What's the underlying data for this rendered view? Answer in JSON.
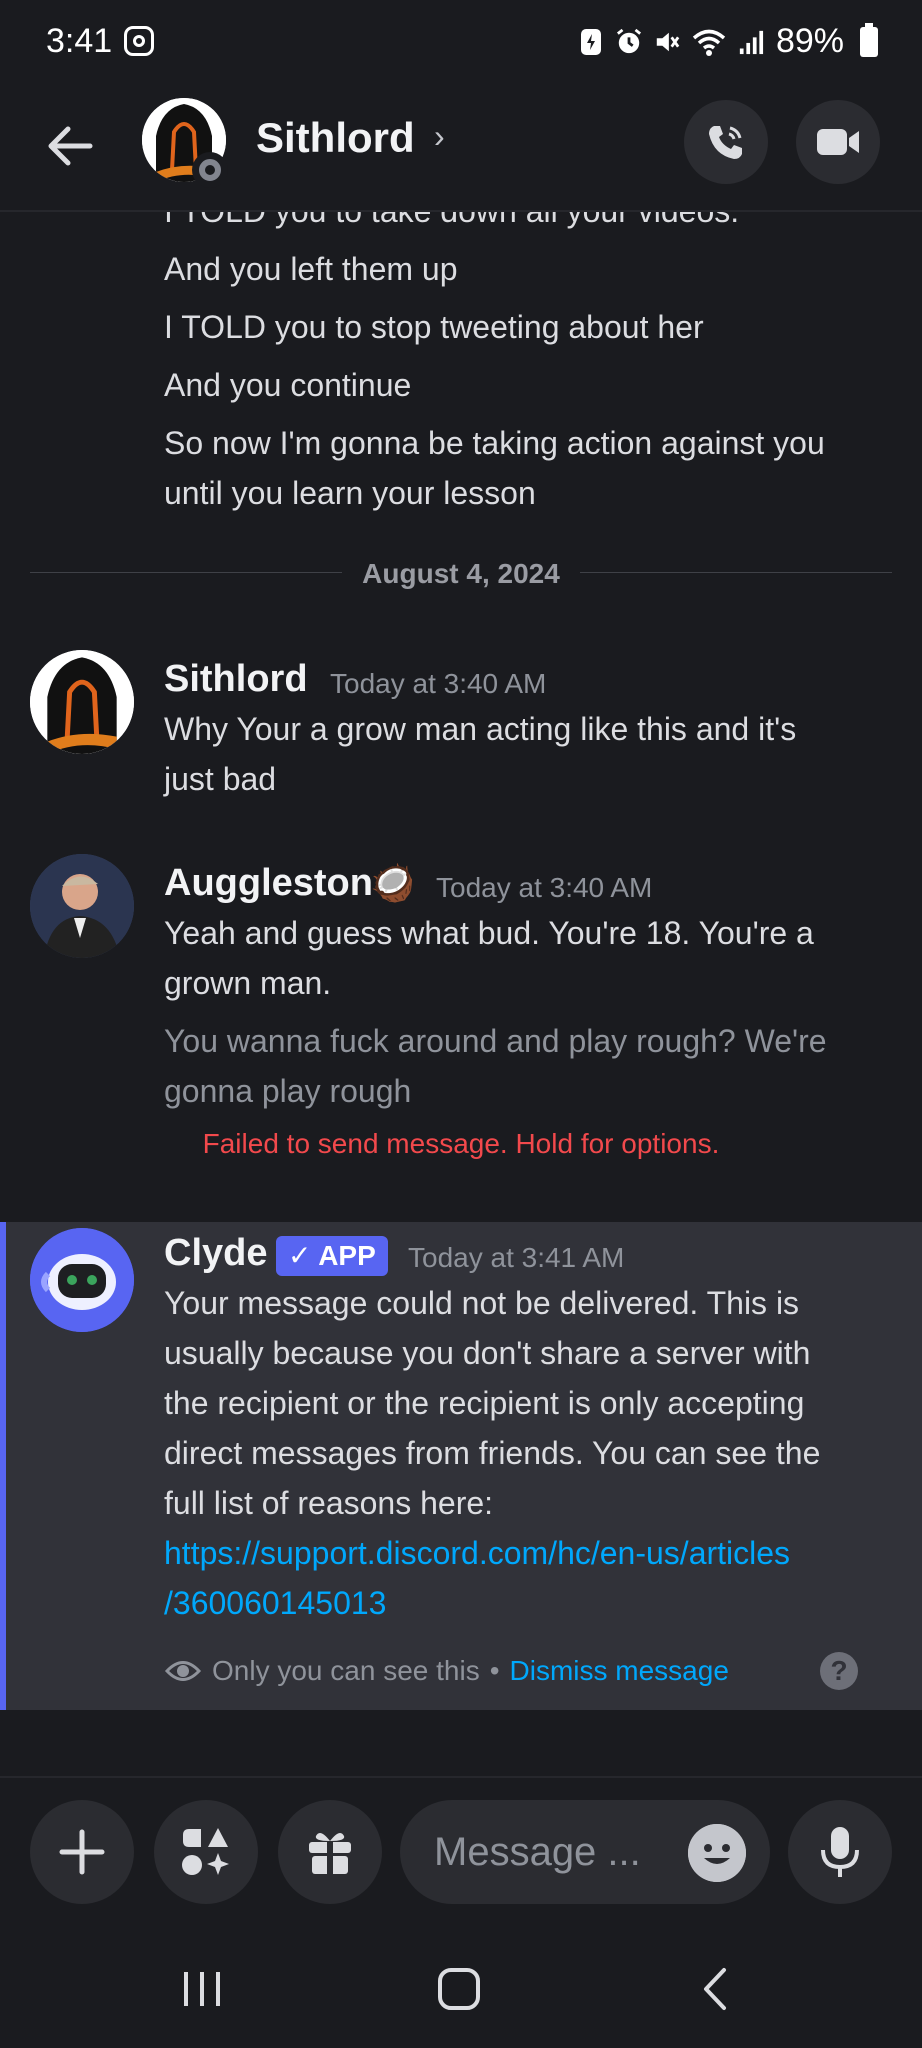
{
  "status_bar": {
    "time": "3:41",
    "battery": "89%"
  },
  "header": {
    "contact_name": "Sithlord",
    "chevron": "›"
  },
  "messages": {
    "previous_lines": [
      "I TOLD you to take down all your videos.",
      "And you left them up",
      "I TOLD you to stop tweeting about her",
      "And you continue",
      "So now I'm gonna be taking action against you",
      "until you learn your lesson"
    ],
    "date_divider": "August 4, 2024",
    "sithlord": {
      "author": "Sithlord",
      "timestamp": "Today at 3:40 AM",
      "lines": [
        "Why Your a grow man acting like this and it's",
        "just bad"
      ]
    },
    "auggleston": {
      "author": "Auggleston",
      "timestamp": "Today at 3:40 AM",
      "lines": [
        "Yeah and guess what bud. You're 18. You're a",
        "grown man."
      ],
      "failed_lines": [
        "You wanna fuck around and play rough? We're",
        "gonna play rough"
      ],
      "failed_notice": "Failed to send message. Hold for options."
    },
    "clyde": {
      "author": "Clyde",
      "tag": "✓ APP",
      "timestamp": "Today at 3:41 AM",
      "lines": [
        "Your message could not be delivered. This is",
        "usually because you don't share a server with",
        "the recipient or the recipient is only accepting",
        "direct messages from friends. You can see the",
        "full list of reasons here:"
      ],
      "link_lines": [
        "https://support.discord.com/hc/en-us/articles",
        "/360060145013"
      ],
      "only_you": "Only you can see this",
      "separator": "•",
      "dismiss": "Dismiss message",
      "help": "?"
    }
  },
  "composer": {
    "placeholder": "Message ..."
  },
  "colors": {
    "accent": "#5865f2",
    "link": "#00a8fc",
    "error": "#f2494c",
    "background": "#1a1b1f"
  }
}
